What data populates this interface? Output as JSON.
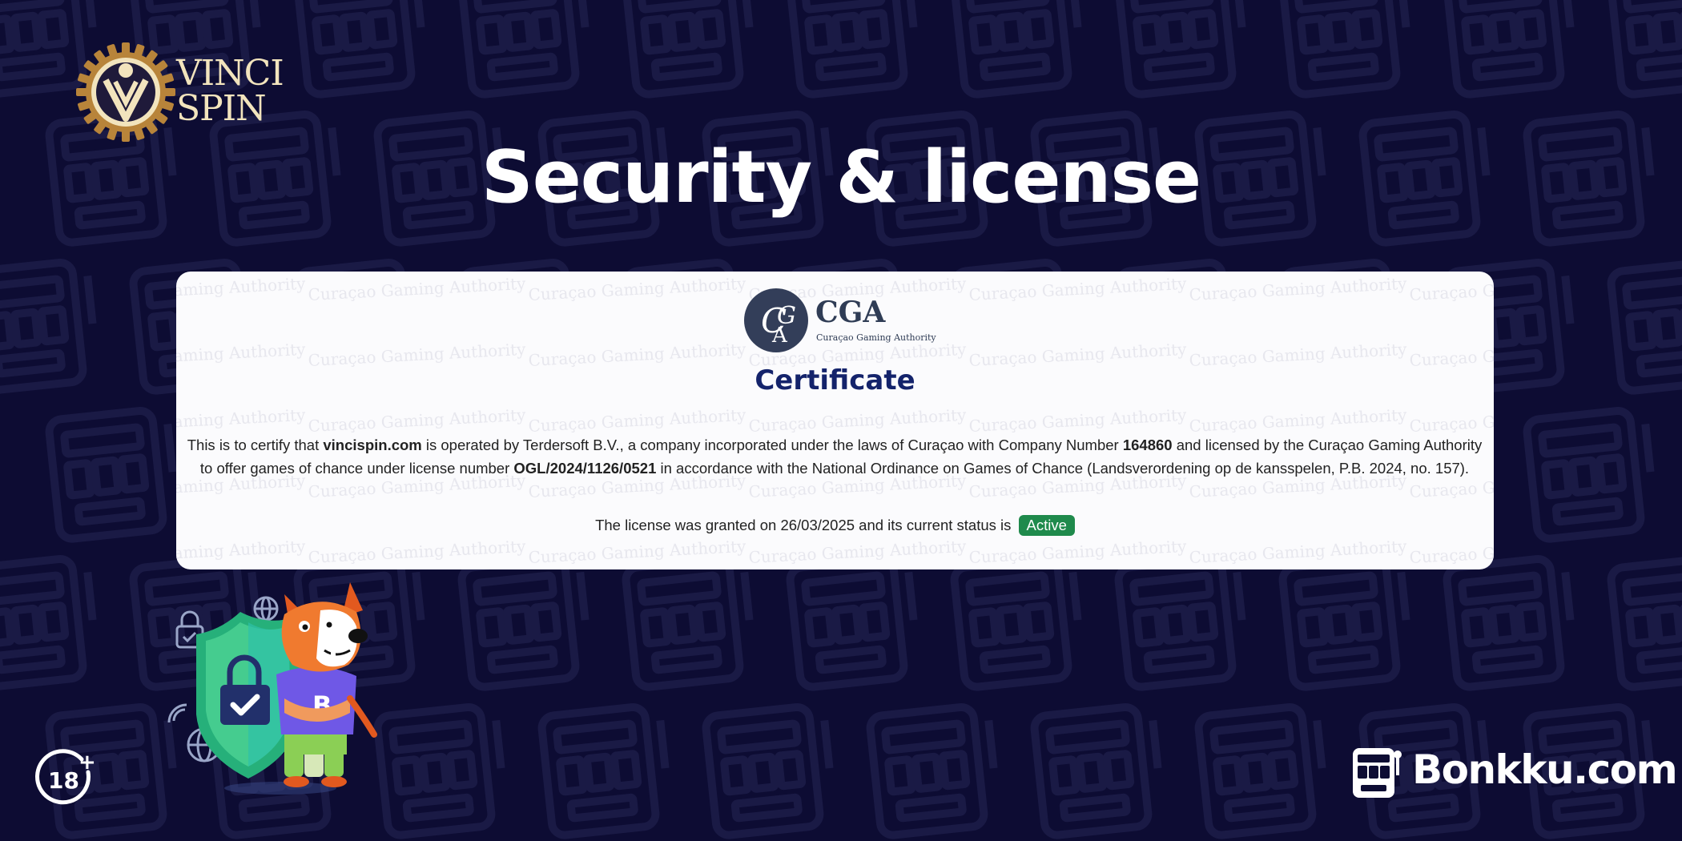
{
  "brand": {
    "logo_line1": "VINCI",
    "logo_line2": "SPIN"
  },
  "page_title": "Security & license",
  "certificate": {
    "authority_abbr": "CGA",
    "authority_name": "Curaçao Gaming Authority",
    "watermark_text": "Curaçao Gaming Authority",
    "title": "Certificate",
    "body": {
      "t1": "This is to certify that ",
      "domain": "vincispin.com",
      "t2": " is operated by Terdersoft B.V., a company incorporated under the laws of Curaçao with Company Number ",
      "company_number": "164860",
      "t3": " and licensed by the Curaçao Gaming Authority to offer games of chance under license number ",
      "license_number": "OGL/2024/1126/0521",
      "t4": " in accordance with the National Ordinance on Games of Chance (Landsverordening op de kansspelen, P.B. 2024, no. 157)."
    },
    "status_text": "The license was granted on 26/03/2025 and its current status is",
    "status_badge": "Active"
  },
  "age_badge": {
    "label": "18",
    "plus": "+"
  },
  "footer_brand": "Bonkku.com",
  "mascot_shirt_letter": "B",
  "colors": {
    "background": "#0d0c33",
    "title": "#ffffff",
    "certificate_title": "#14236b",
    "active_badge": "#1f8a4c",
    "logo_gold": "#b8843a"
  },
  "icons": [
    "vincispin-gear-logo",
    "cga-emblem-icon",
    "shield-icon",
    "padlock-icon",
    "checkmark-icon",
    "globe-icon",
    "wifi-icon",
    "dog-mascot",
    "age-18-plus-icon",
    "slot-machine-icon"
  ]
}
